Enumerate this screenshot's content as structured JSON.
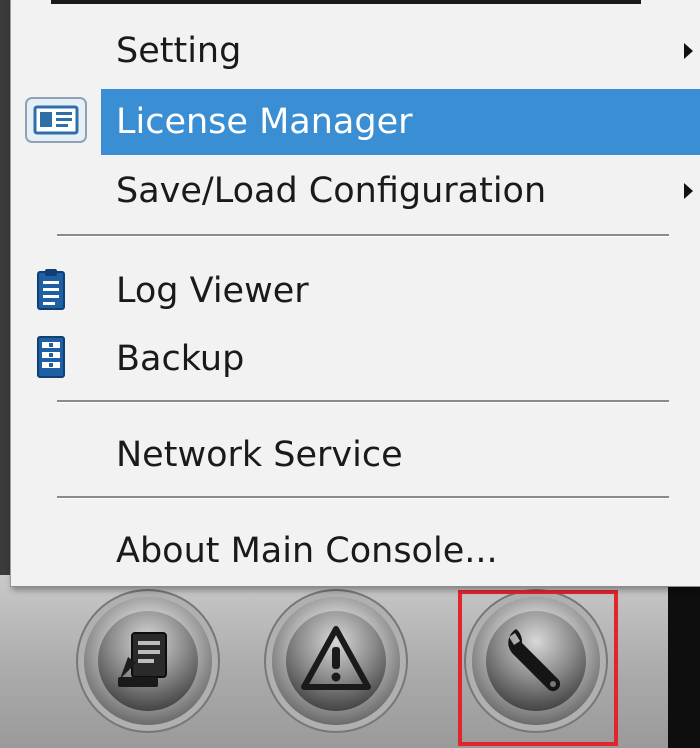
{
  "menu": {
    "items": [
      {
        "label": "Setting",
        "icon": "",
        "submenu": true,
        "selected": false
      },
      {
        "label": "License Manager",
        "icon": "license-card-icon",
        "submenu": false,
        "selected": true
      },
      {
        "label": "Save/Load Configuration",
        "icon": "",
        "submenu": true,
        "selected": false
      },
      {
        "label": "Log Viewer",
        "icon": "clipboard-log-icon",
        "submenu": false,
        "selected": false
      },
      {
        "label": "Backup",
        "icon": "backup-icon",
        "submenu": false,
        "selected": false
      },
      {
        "label": "Network Service",
        "icon": "",
        "submenu": false,
        "selected": false
      },
      {
        "label": "About Main Console...",
        "icon": "",
        "submenu": false,
        "selected": false
      }
    ]
  },
  "taskbar": {
    "buttons": [
      {
        "icon": "edit-document-icon"
      },
      {
        "icon": "warning-icon"
      },
      {
        "icon": "wrench-icon",
        "highlighted": true
      }
    ]
  },
  "colors": {
    "selection": "#3a8ed4",
    "highlight_box": "#e0262c",
    "menu_bg": "#f2f2f2"
  }
}
